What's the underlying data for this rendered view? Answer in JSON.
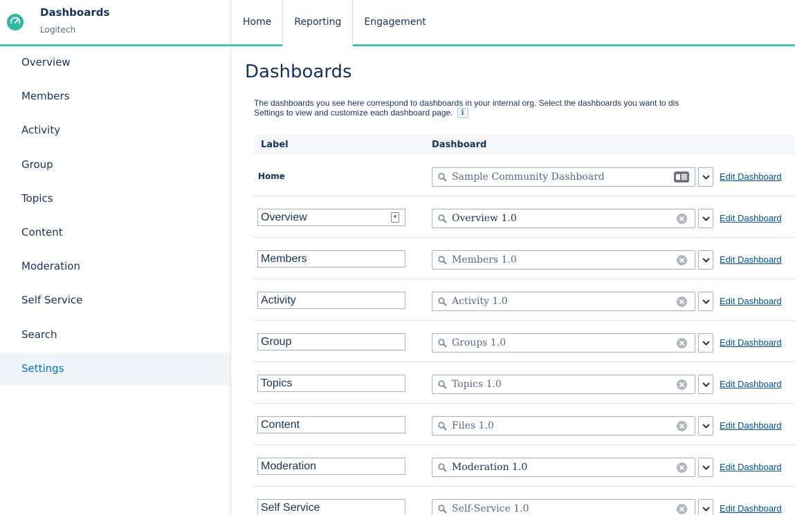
{
  "header": {
    "app_title": "Dashboards",
    "org_name": "Logitech",
    "tabs": [
      {
        "label": "Home"
      },
      {
        "label": "Reporting",
        "active": true
      },
      {
        "label": "Engagement"
      }
    ]
  },
  "sidebar": {
    "items": [
      {
        "label": "Overview"
      },
      {
        "label": "Members"
      },
      {
        "label": "Activity"
      },
      {
        "label": "Group"
      },
      {
        "label": "Topics"
      },
      {
        "label": "Content"
      },
      {
        "label": "Moderation"
      },
      {
        "label": "Self Service"
      },
      {
        "label": "Search"
      },
      {
        "label": "Settings",
        "active": true
      }
    ]
  },
  "main": {
    "title": "Dashboards",
    "description_line1": "The dashboards you see here correspond to dashboards in your internal org. Select the dashboards you want to dis",
    "description_line2": "Settings to view and customize each dashboard page.",
    "info_icon_glyph": "i",
    "table": {
      "columns": {
        "label": "Label",
        "dashboard": "Dashboard"
      },
      "edit_label": "Edit Dashboard",
      "rows": [
        {
          "label": "Home",
          "dashboard": "Sample Community Dashboard"
        },
        {
          "label": "Overview",
          "dashboard": "Overview 1.0"
        },
        {
          "label": "Members",
          "dashboard": "Members 1.0"
        },
        {
          "label": "Activity",
          "dashboard": "Activity 1.0"
        },
        {
          "label": "Group",
          "dashboard": "Groups 1.0"
        },
        {
          "label": "Topics",
          "dashboard": "Topics 1.0"
        },
        {
          "label": "Content",
          "dashboard": "Files 1.0"
        },
        {
          "label": "Moderation",
          "dashboard": "Moderation 1.0"
        },
        {
          "label": "Self Service",
          "dashboard": "Self-Service 1.0"
        }
      ]
    }
  },
  "colors": {
    "accent": "#4bc4b4",
    "brand_icon": "#2fb9a4",
    "link": "#0050a0",
    "active_nav_text": "#0070d2",
    "active_nav_bg": "#f0f6fa"
  },
  "icons": {
    "brand": "speedometer-icon",
    "search": "search-icon",
    "clear": "clear-icon",
    "card": "contact-card-icon",
    "dropdown": "chevron-down-icon",
    "info": "info-icon"
  }
}
